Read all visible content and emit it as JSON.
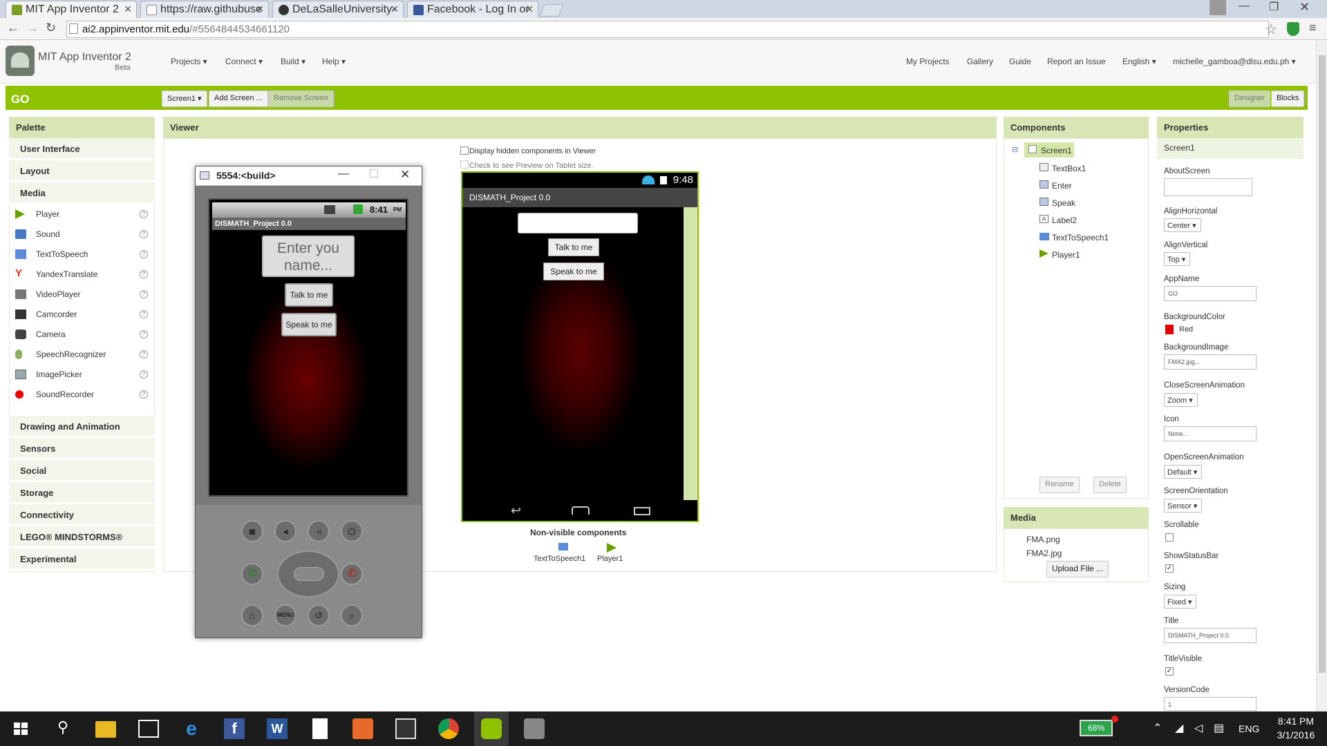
{
  "browser": {
    "tabs": [
      {
        "label": "MIT App Inventor 2",
        "active": true
      },
      {
        "label": "https://raw.githubuse"
      },
      {
        "label": "DeLaSalleUniversity-"
      },
      {
        "label": "Facebook - Log In or"
      }
    ],
    "url_host": "ai2.appinventor.mit.edu",
    "url_rest": "/#5564844534661120"
  },
  "app": {
    "title": "MIT App Inventor 2",
    "subtitle": "Beta",
    "menus": [
      "Projects ▾",
      "Connect ▾",
      "Build ▾",
      "Help ▾"
    ],
    "right_links": [
      "My Projects",
      "Gallery",
      "Guide",
      "Report an Issue",
      "English ▾",
      "michelle_gamboa@dlsu.edu.ph ▾"
    ]
  },
  "toolbar": {
    "project": "GO",
    "screen_select": "Screen1 ▾",
    "add_screen": "Add Screen ...",
    "remove_screen": "Remove Screen",
    "designer": "Designer",
    "blocks": "Blocks"
  },
  "palette": {
    "header": "Palette",
    "categories_top": [
      "User Interface",
      "Layout",
      "Media"
    ],
    "media_items": [
      "Player",
      "Sound",
      "TextToSpeech",
      "YandexTranslate",
      "VideoPlayer",
      "Camcorder",
      "Camera",
      "SpeechRecognizer",
      "ImagePicker",
      "SoundRecorder"
    ],
    "categories_bottom": [
      "Drawing and Animation",
      "Sensors",
      "Social",
      "Storage",
      "Connectivity",
      "LEGO® MINDSTORMS®",
      "Experimental"
    ],
    "help": "?"
  },
  "viewer": {
    "header": "Viewer",
    "hidden_label": "Display hidden components in Viewer",
    "tablet_label": "Check to see Preview on Tablet size.",
    "status_time": "9:48",
    "app_title": "DISMATH_Project 0.0",
    "btn_talk": "Talk to me",
    "btn_speak": "Speak to me",
    "nonvisible_header": "Non-visible components",
    "nonvisible": [
      "TextToSpeech1",
      "Player1"
    ]
  },
  "emulator": {
    "title": "5554:<build>",
    "time": "8:41",
    "ampm": "PM",
    "app_title": "DISMATH_Project 0.0",
    "placeholder": "Enter you name...",
    "btn_talk": "Talk to me",
    "btn_speak": "Speak to me",
    "menu_key": "MENU"
  },
  "components": {
    "header": "Components",
    "root": "Screen1",
    "children": [
      "TextBox1",
      "Enter",
      "Speak",
      "Label2",
      "TextToSpeech1",
      "Player1"
    ],
    "rename": "Rename",
    "delete": "Delete",
    "collapse": "⊟"
  },
  "media": {
    "header": "Media",
    "files": [
      "FMA.png",
      "FMA2.jpg"
    ],
    "upload": "Upload File ..."
  },
  "properties": {
    "header": "Properties",
    "target": "Screen1",
    "AboutScreen": {
      "label": "AboutScreen",
      "value": ""
    },
    "AlignHorizontal": {
      "label": "AlignHorizontal",
      "value": "Center ▾"
    },
    "AlignVertical": {
      "label": "AlignVertical",
      "value": "Top ▾"
    },
    "AppName": {
      "label": "AppName",
      "value": "GO"
    },
    "BackgroundColor": {
      "label": "BackgroundColor",
      "value": "Red",
      "swatch": "#e10000"
    },
    "BackgroundImage": {
      "label": "BackgroundImage",
      "value": "FMA2.jpg..."
    },
    "CloseScreenAnimation": {
      "label": "CloseScreenAnimation",
      "value": "Zoom ▾"
    },
    "Icon": {
      "label": "Icon",
      "value": "None..."
    },
    "OpenScreenAnimation": {
      "label": "OpenScreenAnimation",
      "value": "Default ▾"
    },
    "ScreenOrientation": {
      "label": "ScreenOrientation",
      "value": "Sensor ▾"
    },
    "Scrollable": {
      "label": "Scrollable",
      "checked": false
    },
    "ShowStatusBar": {
      "label": "ShowStatusBar",
      "checked": true
    },
    "Sizing": {
      "label": "Sizing",
      "value": "Fixed ▾"
    },
    "Title": {
      "label": "Title",
      "value": "DISMATH_Project 0.0"
    },
    "TitleVisible": {
      "label": "TitleVisible",
      "checked": true
    },
    "VersionCode": {
      "label": "VersionCode",
      "value": "1"
    }
  },
  "taskbar": {
    "battery": "68%",
    "lang": "ENG",
    "time": "8:41 PM",
    "date": "3/1/2016"
  },
  "colors": {
    "accent": "#8fc202",
    "panel_head": "#d8e6b6"
  }
}
